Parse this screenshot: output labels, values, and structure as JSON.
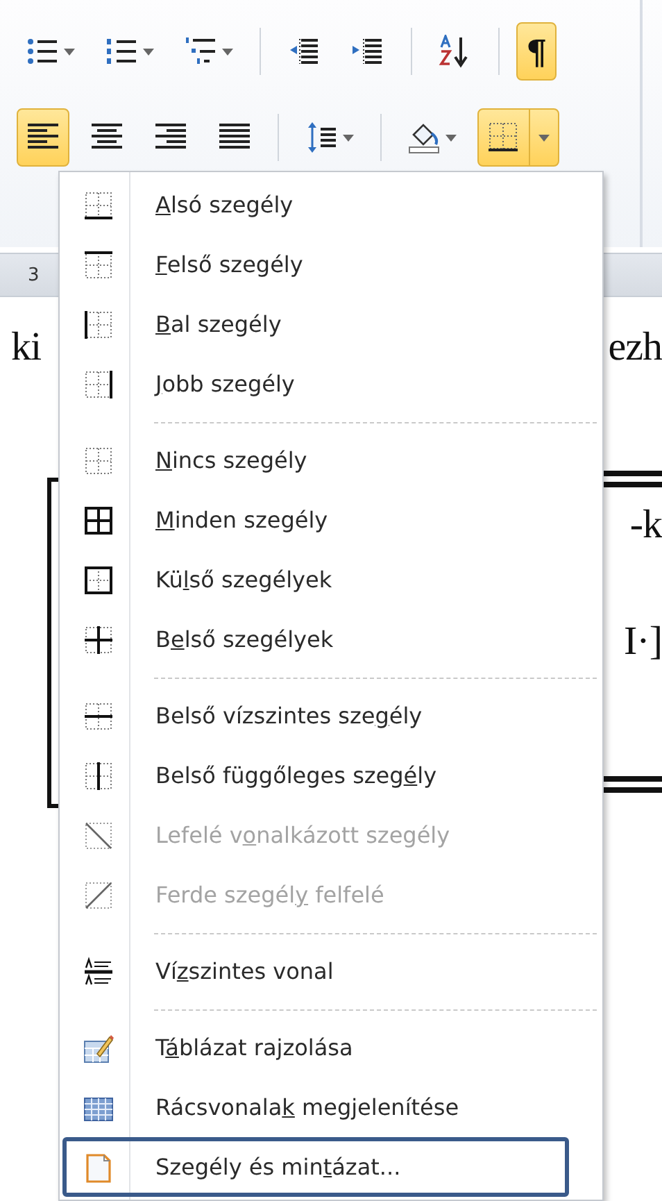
{
  "ribbon": {
    "rows": [
      [
        {
          "kind": "bullets",
          "selected": false,
          "dropdown": true
        },
        {
          "kind": "numbering",
          "selected": false,
          "dropdown": true
        },
        {
          "kind": "multilevel",
          "selected": false,
          "dropdown": true
        },
        {
          "kind": "separator"
        },
        {
          "kind": "outdent",
          "selected": false
        },
        {
          "kind": "indent",
          "selected": false
        },
        {
          "kind": "separator"
        },
        {
          "kind": "sort",
          "selected": false
        },
        {
          "kind": "separator"
        },
        {
          "kind": "pilcrow",
          "selected": true,
          "glyph": "¶"
        }
      ],
      [
        {
          "kind": "align-left",
          "selected": true
        },
        {
          "kind": "align-center",
          "selected": false
        },
        {
          "kind": "align-right",
          "selected": false
        },
        {
          "kind": "justify",
          "selected": false
        },
        {
          "kind": "separator"
        },
        {
          "kind": "line-spacing",
          "selected": false,
          "dropdown": true
        },
        {
          "kind": "separator"
        },
        {
          "kind": "shading",
          "selected": false,
          "dropdown": true
        },
        {
          "kind": "borders",
          "selected": true,
          "dropdown": true
        }
      ]
    ]
  },
  "ruler": {
    "left_mark": "3"
  },
  "document": {
    "left_fragment": "ki",
    "right_fragments": [
      "ezh",
      "-k",
      "I·]"
    ]
  },
  "menu": {
    "groups": [
      {
        "items": [
          {
            "key": "A",
            "post": "lsó szegély",
            "disabled": false,
            "selected": false
          },
          {
            "key": "F",
            "post": "első szegély",
            "disabled": false,
            "selected": false
          },
          {
            "key": "B",
            "post": "al szegély",
            "disabled": false,
            "selected": false
          },
          {
            "key": "J",
            "post": "obb szegély",
            "disabled": false,
            "selected": false
          }
        ]
      },
      {
        "items": [
          {
            "key": "N",
            "post": "incs szegély",
            "disabled": false,
            "selected": false
          },
          {
            "key": "M",
            "post": "inden szegély",
            "disabled": false,
            "selected": false
          },
          {
            "pre": "Kü",
            "key": "l",
            "post": "ső szegélyek",
            "disabled": false,
            "selected": false
          },
          {
            "pre": "B",
            "key": "e",
            "post": "lső szegélyek",
            "disabled": false,
            "selected": false
          }
        ]
      },
      {
        "items": [
          {
            "pre": "Belső vízszintes sze",
            "key": "g",
            "post": "ély",
            "disabled": false,
            "selected": false
          },
          {
            "pre": "Belső függőleges szeg",
            "key": "é",
            "post": "ly",
            "disabled": false,
            "selected": false
          },
          {
            "pre": "Lefelé v",
            "key": "o",
            "post": "nalkázott szegély",
            "disabled": true,
            "selected": false
          },
          {
            "pre": "Ferde szegél",
            "key": "y",
            "post": " felfelé",
            "disabled": true,
            "selected": false
          }
        ]
      },
      {
        "items": [
          {
            "pre": "Ví",
            "key": "z",
            "post": "szintes vonal",
            "disabled": false,
            "selected": false
          }
        ]
      },
      {
        "items": [
          {
            "pre": "T",
            "key": "á",
            "post": "blázat rajzolása",
            "disabled": false,
            "selected": false
          },
          {
            "pre": "Rácsvonala",
            "key": "k",
            "post": " megjelenítése",
            "disabled": false,
            "selected": false
          },
          {
            "pre": "Szegély és min",
            "key": "t",
            "post": "ázat...",
            "disabled": false,
            "selected": true
          }
        ]
      }
    ]
  }
}
